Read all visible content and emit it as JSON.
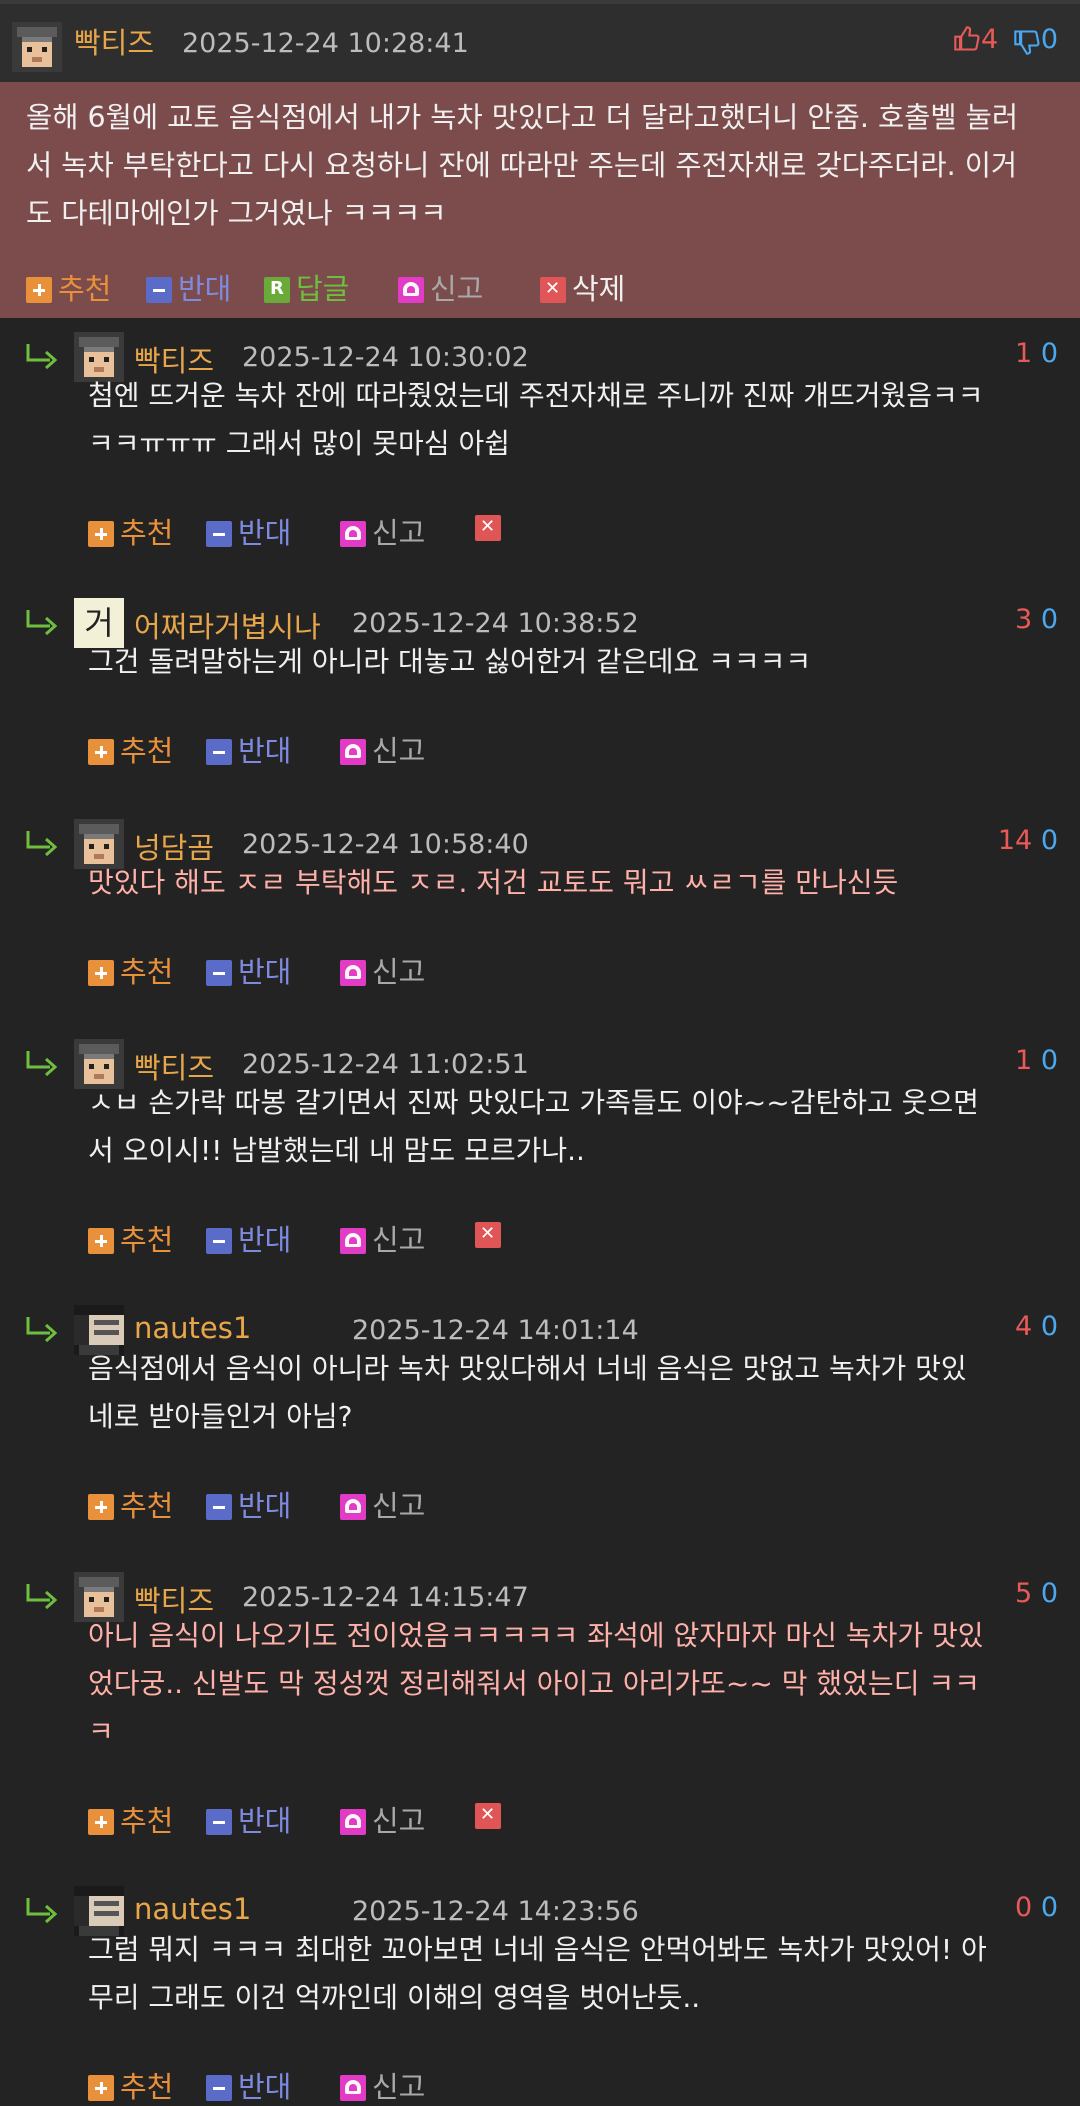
{
  "post": {
    "nick": "빡티즈",
    "date": "2025-12-24 10:28:41",
    "up": "4",
    "down": "0",
    "lines": [
      "올해 6월에 교토 음식점에서 내가 녹차 맛있다고 더 달라고했더니 안줌. 호출벨 눌러",
      "서 녹차 부탁한다고 다시 요청하니 잔에 따라만 주는데 주전자채로 갖다주더라. 이거",
      "도 다테마에인가 그거였나 ㅋㅋㅋㅋ"
    ],
    "actions": {
      "recommend": "추천",
      "oppose": "반대",
      "reply": "답글",
      "report": "신고",
      "delete": "삭제"
    }
  },
  "comments": [
    {
      "nick": "빡티즈",
      "date": "2025-12-24 10:30:02",
      "up": "1",
      "down": "0",
      "avatar": "pixel",
      "lines": [
        "첨엔 뜨거운 녹차 잔에 따라줬었는데 주전자채로 주니까 진짜 개뜨거웠음ㅋㅋ",
        "ㅋㅋㅠㅠㅠ 그래서 많이 못마심 아쉽"
      ],
      "best": false,
      "deletable": true
    },
    {
      "nick": "어쩌라거볍시나",
      "date": "2025-12-24 10:38:52",
      "up": "3",
      "down": "0",
      "avatar": "char",
      "avatar_char": "거",
      "lines": [
        "그건 돌려말하는게 아니라 대놓고 싫어한거 같은데요 ㅋㅋㅋㅋ"
      ],
      "best": false,
      "deletable": false
    },
    {
      "nick": "넝담곰",
      "date": "2025-12-24 10:58:40",
      "up": "14",
      "down": "0",
      "avatar": "pixel",
      "lines": [
        "맛있다 해도 ㅈㄹ 부탁해도 ㅈㄹ. 저건 교토도 뭐고 ㅆㄹㄱ를 만나신듯"
      ],
      "best": true,
      "deletable": false
    },
    {
      "nick": "빡티즈",
      "date": "2025-12-24 11:02:51",
      "up": "1",
      "down": "0",
      "avatar": "pixel",
      "lines": [
        "ㅅㅂ 손가락 따봉 갈기면서 진짜 맛있다고 가족들도 이야~~감탄하고 웃으면",
        "서 오이시!! 남발했는데 내 맘도 모르가나.."
      ],
      "best": false,
      "deletable": true
    },
    {
      "nick": "nautes1",
      "date": "2025-12-24 14:01:14",
      "up": "4",
      "down": "0",
      "avatar": "manga",
      "lines": [
        "음식점에서 음식이 아니라 녹차 맛있다해서 너네 음식은 맛없고 녹차가 맛있",
        "네로 받아들인거 아님?"
      ],
      "best": false,
      "deletable": false
    },
    {
      "nick": "빡티즈",
      "date": "2025-12-24 14:15:47",
      "up": "5",
      "down": "0",
      "avatar": "pixel",
      "lines": [
        "아니 음식이 나오기도 전이었음ㅋㅋㅋㅋㅋ 좌석에 앉자마자 마신 녹차가 맛있",
        "었다궁.. 신발도 막 정성껏 정리해줘서 아이고 아리가또~~ 막 했었는디 ㅋㅋ",
        "ㅋ"
      ],
      "best": true,
      "deletable": true
    },
    {
      "nick": "nautes1",
      "date": "2025-12-24 14:23:56",
      "up": "0",
      "down": "0",
      "avatar": "manga",
      "lines": [
        "그럼 뭐지 ㅋㅋㅋ 최대한 꼬아보면 너네 음식은 안먹어봐도 녹차가 맛있어! 아",
        "무리 그래도 이건 억까인데 이해의 영역을 벗어난듯.."
      ],
      "best": false,
      "deletable": false
    }
  ],
  "comment_actions": {
    "recommend": "추천",
    "oppose": "반대",
    "report": "신고"
  },
  "colors": {
    "nick": "#e8a64a",
    "up": "#e85a58",
    "down": "#4aa8f0",
    "post_bg": "#7b4c4b",
    "page_bg": "#232323"
  },
  "icons": {
    "thumb_up": "thumbs-up-icon",
    "thumb_down": "thumbs-down-icon",
    "reply_arrow": "reply-arrow-icon"
  }
}
